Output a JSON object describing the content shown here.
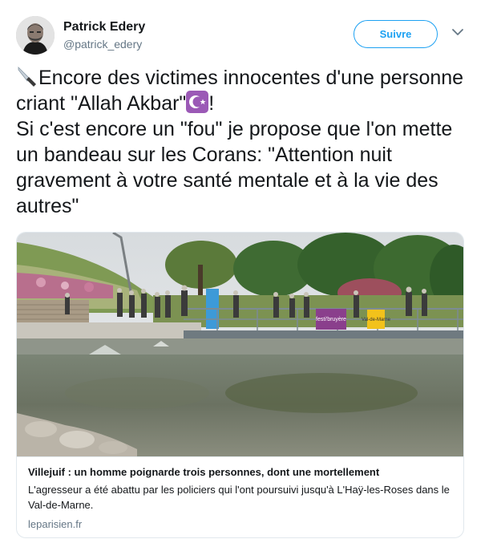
{
  "author": {
    "display_name": "Patrick Edery",
    "handle": "@patrick_edery"
  },
  "follow_button": {
    "label": "Suivre"
  },
  "tweet": {
    "line_1_text": "Encore des victimes innocentes d'une personne criant \"Allah Akbar\"",
    "line_1_end": "!",
    "line_2": "Si c'est encore un \"fou\" je propose que l'on mette un bandeau sur les Corans: \"Attention nuit gravement à votre santé mentale et à la vie des autres\"",
    "emoji_1": "knife-icon",
    "emoji_2": "star-and-crescent-icon"
  },
  "link_card": {
    "title": "Villejuif : un homme poignarde trois personnes, dont une mortellement",
    "description": "L'agresseur a été abattu par les policiers qui l'ont poursuivi jusqu'à L'Haÿ-les-Roses dans le Val-de-Marne.",
    "domain": "leparisien.fr",
    "image_signs": [
      "festi'bruyère",
      "Val-de-Marne"
    ]
  },
  "colors": {
    "accent": "#1da1f2",
    "text": "#14171a",
    "secondary_text": "#657786",
    "border": "#e1e8ed",
    "emoji_purple": "#9b59b6"
  }
}
